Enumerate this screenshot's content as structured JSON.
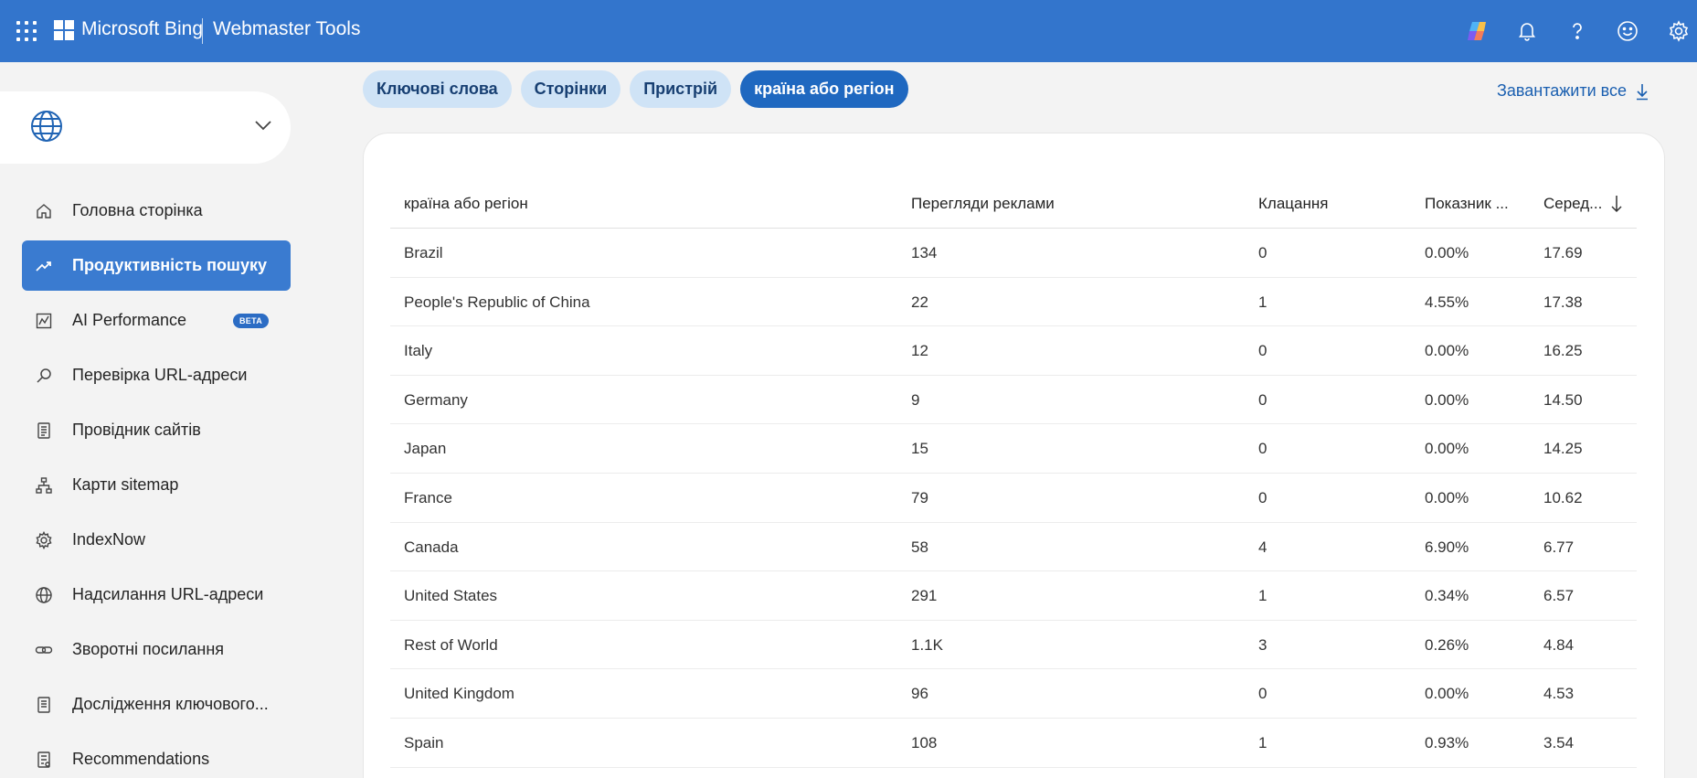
{
  "header": {
    "brand": "Microsoft Bing",
    "product": "Webmaster Tools",
    "icons": [
      "copilot-icon",
      "bell-icon",
      "help-icon",
      "smiley-icon",
      "gear-icon"
    ]
  },
  "sidebar": {
    "items": [
      {
        "label": "Головна сторінка",
        "icon": "home-icon"
      },
      {
        "label": "Продуктивність пошуку",
        "icon": "trend-icon",
        "active": true
      },
      {
        "label": "AI Performance",
        "icon": "chart-icon",
        "badge": "BETA"
      },
      {
        "label": "Перевірка URL-адреси",
        "icon": "search-icon"
      },
      {
        "label": "Провідник сайтів",
        "icon": "document-icon"
      },
      {
        "label": "Карти sitemap",
        "icon": "sitemap-icon"
      },
      {
        "label": "IndexNow",
        "icon": "gear-icon"
      },
      {
        "label": "Надсилання URL-адреси",
        "icon": "globe-icon"
      },
      {
        "label": "Зворотні посилання",
        "icon": "link-icon"
      },
      {
        "label": "Дослідження ключового...",
        "icon": "document-icon"
      },
      {
        "label": "Recommendations",
        "icon": "list-icon"
      }
    ]
  },
  "tabs": [
    {
      "label": "Ключові слова"
    },
    {
      "label": "Сторінки"
    },
    {
      "label": "Пристрій"
    },
    {
      "label": "країна або регіон",
      "active": true
    }
  ],
  "download_label": "Завантажити все",
  "table": {
    "headers": [
      "країна або регіон",
      "Перегляди реклами",
      "Клацання",
      "Показник ...",
      "Серед..."
    ],
    "rows": [
      [
        "Brazil",
        "134",
        "0",
        "0.00%",
        "17.69"
      ],
      [
        "People's Republic of China",
        "22",
        "1",
        "4.55%",
        "17.38"
      ],
      [
        "Italy",
        "12",
        "0",
        "0.00%",
        "16.25"
      ],
      [
        "Germany",
        "9",
        "0",
        "0.00%",
        "14.50"
      ],
      [
        "Japan",
        "15",
        "0",
        "0.00%",
        "14.25"
      ],
      [
        "France",
        "79",
        "0",
        "0.00%",
        "10.62"
      ],
      [
        "Canada",
        "58",
        "4",
        "6.90%",
        "6.77"
      ],
      [
        "United States",
        "291",
        "1",
        "0.34%",
        "6.57"
      ],
      [
        "Rest of World",
        "1.1K",
        "3",
        "0.26%",
        "4.84"
      ],
      [
        "United Kingdom",
        "96",
        "0",
        "0.00%",
        "4.53"
      ],
      [
        "Spain",
        "108",
        "1",
        "0.93%",
        "3.54"
      ]
    ]
  },
  "colors": {
    "header": "#3375cc",
    "active_nav": "#3a7bd0",
    "active_tab": "#1f68c0",
    "tab": "#cfe3f6"
  }
}
